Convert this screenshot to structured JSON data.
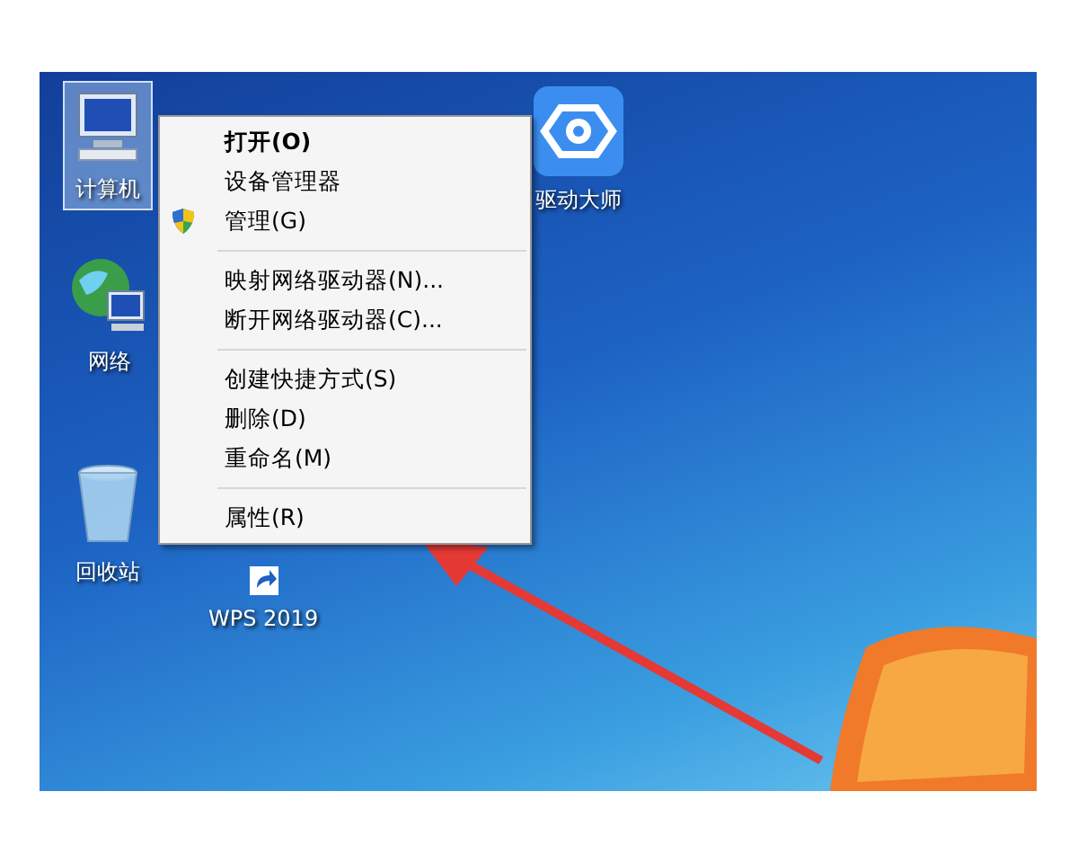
{
  "desktop_icons": [
    {
      "kind": "computer",
      "label": "计算机",
      "selected": true
    },
    {
      "kind": "network",
      "label": "网络",
      "selected": false
    },
    {
      "kind": "recycle",
      "label": "回收站",
      "selected": false
    },
    {
      "kind": "wps",
      "label": "WPS 2019",
      "selected": false
    },
    {
      "kind": "driver",
      "label": "驱动大师",
      "selected": false
    }
  ],
  "context_menu": [
    {
      "kind": "item",
      "label": "打开(O)",
      "default": true
    },
    {
      "kind": "item",
      "label": "设备管理器",
      "default": false
    },
    {
      "kind": "shield_item",
      "label": "管理(G)",
      "default": false
    },
    {
      "kind": "separator"
    },
    {
      "kind": "item",
      "label": "映射网络驱动器(N)...",
      "default": false
    },
    {
      "kind": "item",
      "label": "断开网络驱动器(C)...",
      "default": false
    },
    {
      "kind": "separator"
    },
    {
      "kind": "item",
      "label": "创建快捷方式(S)",
      "default": false
    },
    {
      "kind": "item",
      "label": "删除(D)",
      "default": false
    },
    {
      "kind": "item",
      "label": "重命名(M)",
      "default": false
    },
    {
      "kind": "separator"
    },
    {
      "kind": "item",
      "label": "属性(R)",
      "default": false
    }
  ]
}
